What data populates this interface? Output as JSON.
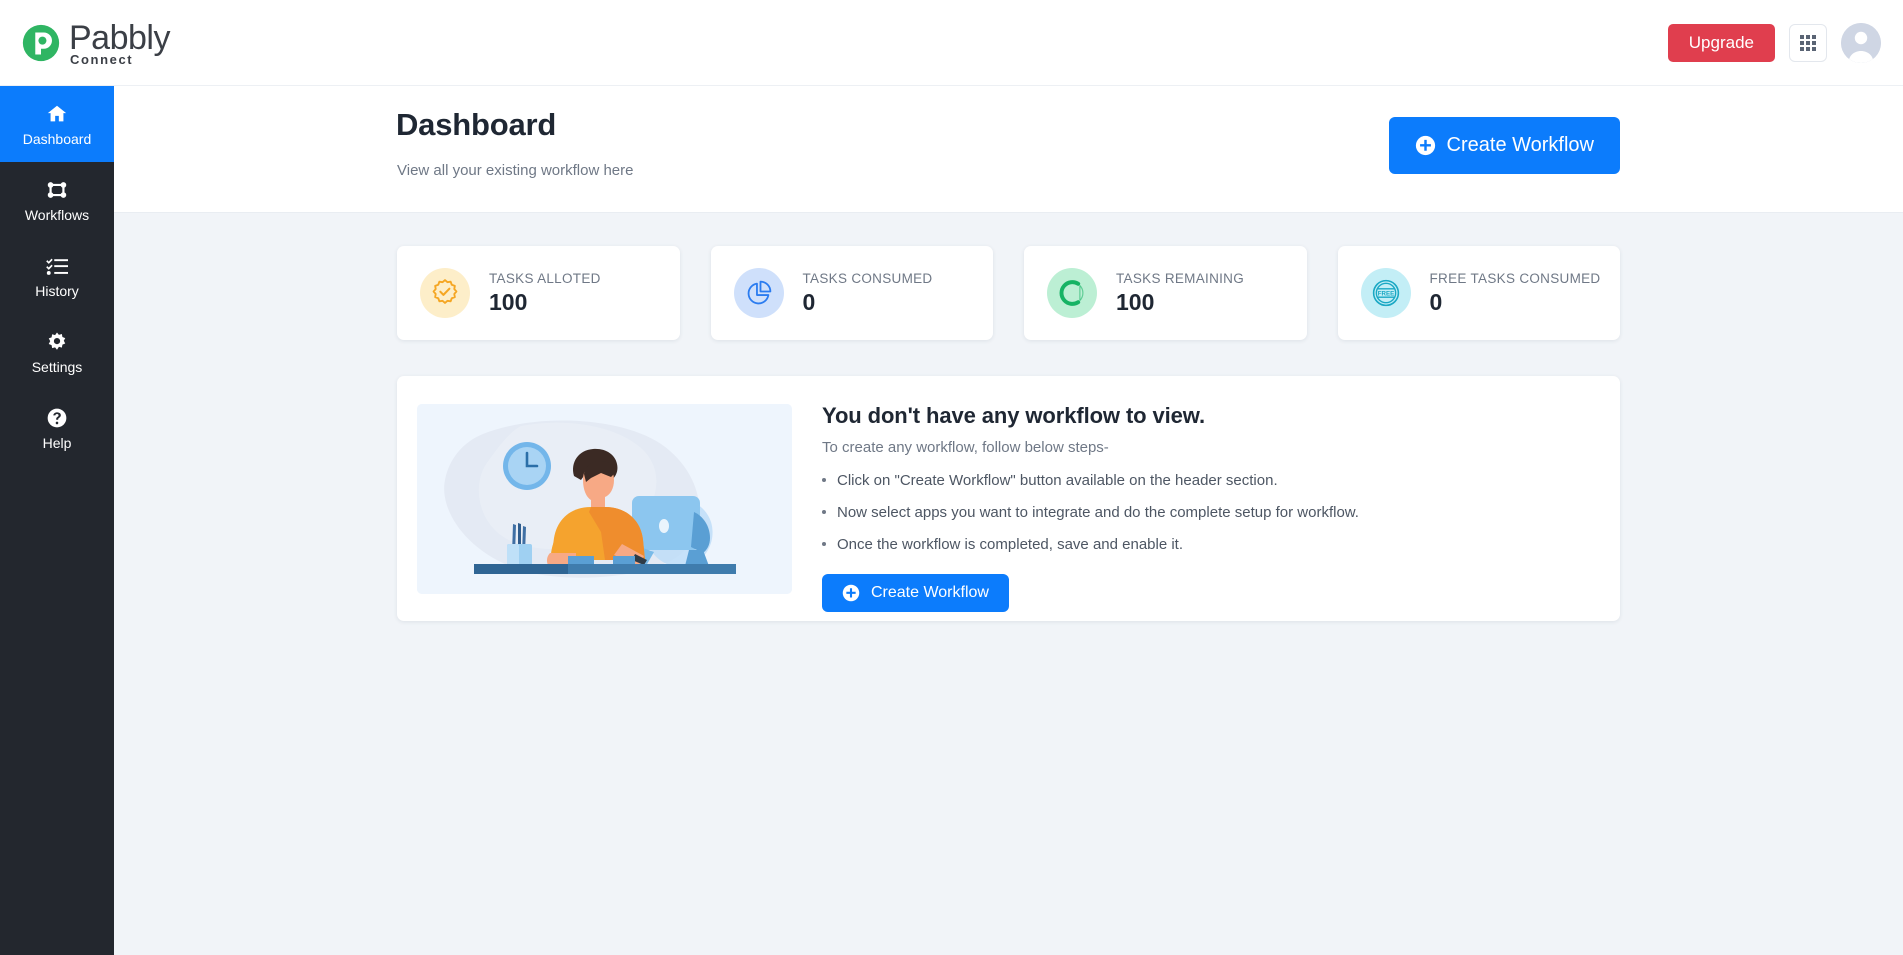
{
  "brand": {
    "name": "Pabbly",
    "sub": "Connect",
    "green": "#2fb563",
    "accent_blue": "#0c7cfc",
    "danger_red": "#e03e4e",
    "sidebar_bg": "#23272e",
    "page_bg": "#f1f4f8"
  },
  "topbar": {
    "upgrade_label": "Upgrade",
    "apps_icon": "grid-apps-icon",
    "avatar_icon": "user-avatar-icon"
  },
  "sidebar": {
    "items": [
      {
        "label": "Dashboard",
        "icon": "home-icon",
        "active": true
      },
      {
        "label": "Workflows",
        "icon": "workflows-nodes-icon",
        "active": false
      },
      {
        "label": "History",
        "icon": "list-checklist-icon",
        "active": false
      },
      {
        "label": "Settings",
        "icon": "gear-icon",
        "active": false
      },
      {
        "label": "Help",
        "icon": "question-circle-icon",
        "active": false
      }
    ]
  },
  "page": {
    "title": "Dashboard",
    "subtitle": "View all your existing workflow here",
    "create_label": "Create Workflow",
    "create_icon": "plus-circle-icon"
  },
  "stats": [
    {
      "label": "TASKS ALLOTED",
      "value": "100",
      "icon": "badge-check-icon",
      "icon_color": "#f5a623",
      "bubble_color": "#fdeec9"
    },
    {
      "label": "TASKS CONSUMED",
      "value": "0",
      "icon": "pie-chart-icon",
      "icon_color": "#2b7cf0",
      "bubble_color": "#cfe0fb"
    },
    {
      "label": "TASKS REMAINING",
      "value": "100",
      "icon": "donut-progress-icon",
      "icon_color": "#16b364",
      "bubble_color": "#bcefd4"
    },
    {
      "label": "FREE TASKS CONSUMED",
      "value": "0",
      "icon": "free-stamp-icon",
      "icon_color": "#1aa8c4",
      "bubble_color": "#c3eef6",
      "icon_text": "FREE"
    }
  ],
  "empty_state": {
    "illustration": "person-at-desk-illustration",
    "title": "You don't have any workflow to view.",
    "subtitle": "To create any workflow, follow below steps-",
    "steps": [
      "Click on \"Create Workflow\" button available on the header section.",
      "Now select apps you want to integrate and do the complete setup for workflow.",
      "Once the workflow is completed, save and enable it."
    ],
    "create_label": "Create Workflow",
    "create_icon": "plus-circle-icon"
  }
}
